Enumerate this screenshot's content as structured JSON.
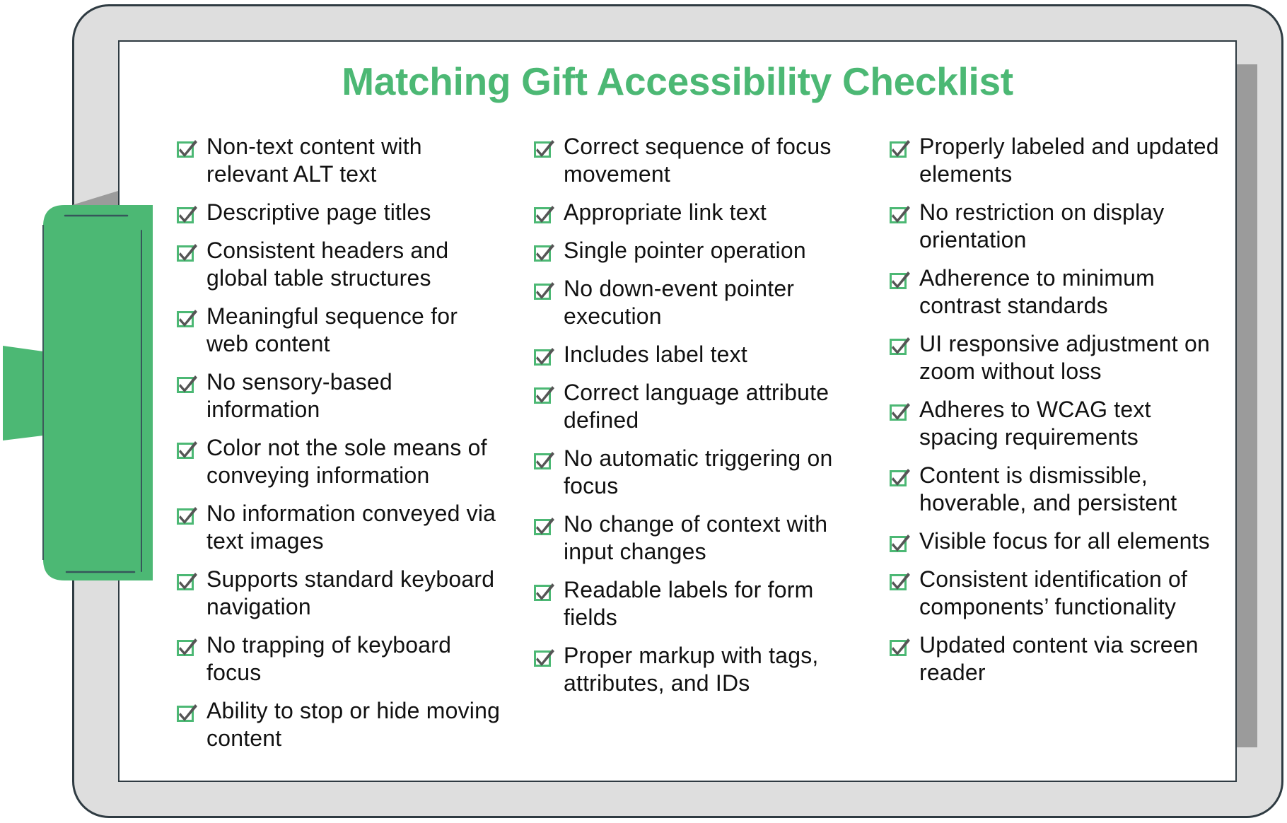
{
  "title": "Matching Gift Accessibility Checklist",
  "colors": {
    "accent": "#4cb874",
    "frame": "#dedede",
    "frame_outline": "#2f3b42",
    "shadow": "#9b9b9b",
    "check": "#555555",
    "text": "#111111"
  },
  "columns": [
    {
      "items": [
        {
          "text": "Non-text content with relevant ALT text",
          "checked": true
        },
        {
          "text": "Descriptive page titles",
          "checked": true
        },
        {
          "text": "Consistent headers and global table structures",
          "checked": true
        },
        {
          "text": "Meaningful sequence for web content",
          "checked": true
        },
        {
          "text": "No sensory-based information",
          "checked": true
        },
        {
          "text": "Color not the sole means of conveying information",
          "checked": true
        },
        {
          "text": "No information conveyed via text images",
          "checked": true
        },
        {
          "text": "Supports standard keyboard navigation",
          "checked": true
        },
        {
          "text": "No trapping of keyboard focus",
          "checked": true
        },
        {
          "text": "Ability to stop or hide moving content",
          "checked": true
        }
      ]
    },
    {
      "items": [
        {
          "text": "Correct sequence of focus movement",
          "checked": true
        },
        {
          "text": "Appropriate link text",
          "checked": true
        },
        {
          "text": "Single pointer operation",
          "checked": true
        },
        {
          "text": "No down-event pointer execution",
          "checked": true
        },
        {
          "text": "Includes label text",
          "checked": true
        },
        {
          "text": "Correct language attribute defined",
          "checked": true
        },
        {
          "text": "No automatic triggering on focus",
          "checked": true
        },
        {
          "text": "No change of context with input changes",
          "checked": true
        },
        {
          "text": "Readable labels for form fields",
          "checked": true
        },
        {
          "text": "Proper markup with tags, attributes, and IDs",
          "checked": true
        }
      ]
    },
    {
      "items": [
        {
          "text": "Properly labeled and updated elements",
          "checked": true
        },
        {
          "text": "No restriction on display orientation",
          "checked": true
        },
        {
          "text": "Adherence to minimum contrast standards",
          "checked": true
        },
        {
          "text": "UI responsive adjustment on zoom without loss",
          "checked": true
        },
        {
          "text": "Adheres to WCAG text spacing requirements",
          "checked": true
        },
        {
          "text": "Content is dismissible, hoverable, and persistent",
          "checked": true
        },
        {
          "text": "Visible focus for all elements",
          "checked": true
        },
        {
          "text": "Consistent identification of components’ functionality",
          "checked": true
        },
        {
          "text": "Updated content via screen reader",
          "checked": true
        }
      ]
    }
  ]
}
